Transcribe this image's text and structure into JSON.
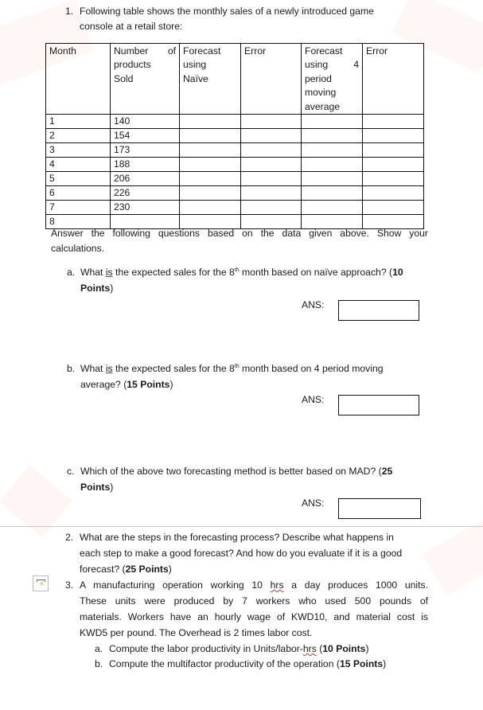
{
  "question1": {
    "number": "1.",
    "intro_line1": "Following table shows the monthly sales of a newly introduced game",
    "intro_line2": "console at a retail store:",
    "table": {
      "headers": {
        "month": "Month",
        "sold_line1_a": "Number",
        "sold_line1_b": "of",
        "sold_line2": "products",
        "sold_line3": "Sold",
        "naive_line1": "Forecast",
        "naive_line2": "using",
        "naive_line3": "Naïve",
        "error1": "Error",
        "ma_line1": "Forecast",
        "ma_line2_a": "using",
        "ma_line2_b": "4",
        "ma_line3": "period",
        "ma_line4": "moving",
        "ma_line5": "average",
        "error2": "Error"
      },
      "rows": [
        {
          "month": "1",
          "sold": "140"
        },
        {
          "month": "2",
          "sold": "154"
        },
        {
          "month": "3",
          "sold": "173"
        },
        {
          "month": "4",
          "sold": "188"
        },
        {
          "month": "5",
          "sold": "206"
        },
        {
          "month": "6",
          "sold": "226"
        },
        {
          "month": "7",
          "sold": "230"
        },
        {
          "month": "8",
          "sold": ""
        }
      ]
    },
    "instruction_line1": "Answer the following questions based on the data given above. Show your",
    "instruction_line2": "calculations.",
    "parts": {
      "a": {
        "letter": "a.",
        "text_pre": "What ",
        "text_is": "is",
        "text_mid": " the expected sales for the 8",
        "sup": "th",
        "text_post": " month based on naïve approach? (",
        "points_inline": "10",
        "line2_bold": "Points",
        "line2_tail": ")",
        "ans_label": "ANS:",
        "ans_value": ""
      },
      "b": {
        "letter": "b.",
        "text_pre": "What ",
        "text_is": "is",
        "text_mid": " the expected sales for the 8",
        "sup": "th",
        "text_post": " month based on 4 period moving",
        "line2_pre": "average? (",
        "line2_bold": "15 Points",
        "line2_tail": ")",
        "ans_label": "ANS:",
        "ans_value": ""
      },
      "c": {
        "letter": "c.",
        "text": "Which of the above two forecasting method is better based on MAD? (",
        "points_inline": "25",
        "line2_bold": "Points",
        "line2_tail": ")",
        "ans_label": "ANS:",
        "ans_value": ""
      }
    }
  },
  "question2": {
    "number": "2.",
    "line1": "What are the steps in the forecasting process? Describe what happens in",
    "line2": "each step to make a good forecast? And how do you evaluate if it is a good",
    "line3_pre": "forecast? (",
    "line3_bold": "25 Points",
    "line3_tail": ")"
  },
  "question3": {
    "number": "3.",
    "line1_pre": "A manufacturing operation working 10 ",
    "line1_hrs": "hrs",
    "line1_post": " a day produces 1000 units.",
    "line2": "These units were produced by 7 workers who used 500 pounds of",
    "line3": "materials. Workers have an hourly wage of KWD10, and material cost is",
    "line4": "KWD5 per pound. The Overhead is 2 times labor cost.",
    "sub_a": {
      "letter": "a.",
      "text_pre": "Compute the labor productivity in Units/labor-",
      "text_hrs": "hrs",
      "text_post": " (",
      "bold": "10 Points",
      "tail": ")"
    },
    "sub_b": {
      "letter": "b.",
      "text_pre": "Compute the multifactor productivity of the operation (",
      "bold": "15 Points",
      "tail": ")"
    }
  },
  "icons": {
    "quick_action": "layout-options-icon"
  }
}
